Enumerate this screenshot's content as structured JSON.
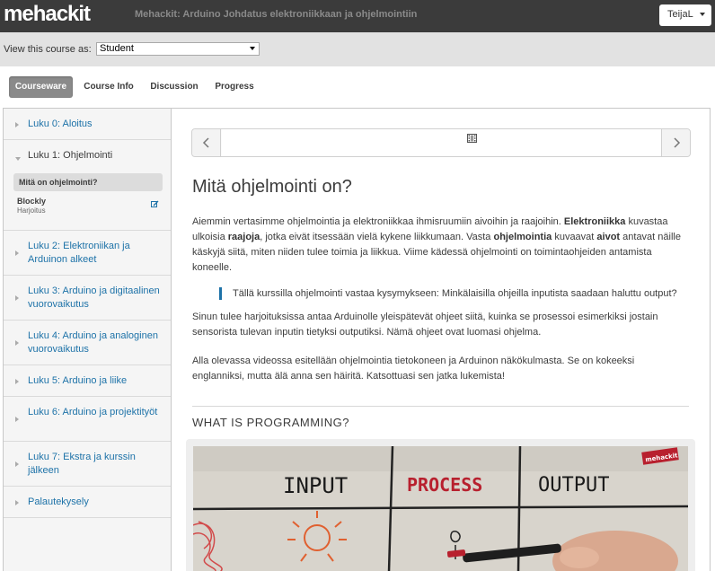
{
  "header": {
    "logo": "mehackit",
    "course_title": "Mehackit: Arduino Johdatus elektroniikkaan ja ohjelmointiin",
    "user_button": "TeijaL"
  },
  "view_bar": {
    "label": "View this course as:",
    "selected": "Student"
  },
  "tabs": [
    {
      "label": "Courseware",
      "active": true
    },
    {
      "label": "Course Info",
      "active": false
    },
    {
      "label": "Discussion",
      "active": false
    },
    {
      "label": "Progress",
      "active": false
    }
  ],
  "sidebar": {
    "chapters": [
      {
        "label": "Luku 0: Aloitus"
      },
      {
        "label": "Luku 1: Ohjelmointi"
      },
      {
        "label": "Luku 2: Elektroniikan ja Arduinon alkeet"
      },
      {
        "label": "Luku 3: Arduino ja digitaalinen vuorovaikutus"
      },
      {
        "label": "Luku 4: Arduino ja analoginen vuorovaikutus"
      },
      {
        "label": "Luku 5: Arduino ja liike"
      },
      {
        "label": "Luku 6: Arduino ja projektityöt"
      },
      {
        "label": "Luku 7: Ekstra ja kurssin jälkeen"
      },
      {
        "label": "Palautekysely"
      }
    ],
    "open_chapter_items": [
      {
        "name": "Mitä on ohjelmointi?",
        "active": true
      },
      {
        "name": "Blockly",
        "sub": "Harjoitus",
        "active": false
      }
    ]
  },
  "content": {
    "title": "Mitä ohjelmointi on?",
    "para1": {
      "t1": "Aiemmin vertasimme ohjelmointia ja elektroniikkaa ihmisruumiin aivoihin ja raajoihin. ",
      "b1": "Elektroniikka",
      "t2": " kuvastaa ulkoisia ",
      "b2": "raajoja",
      "t3": ", jotka eivät itsessään vielä kykene liikkumaan. Vasta ",
      "b3": "ohjelmointia",
      "t4": " kuvaavat ",
      "b4": "aivot",
      "t5": " antavat näille käskyjä siitä, miten niiden tulee toimia ja liikkua. Viime kädessä ohjelmointi on toimintaohjeiden antamista koneelle."
    },
    "quote": "Tällä kurssilla ohjelmointi vastaa kysymykseen: Minkälaisilla ohjeilla inputista saadaan haluttu output?",
    "para2": "Sinun tulee harjoituksissa antaa Arduinolle yleispätevät ohjeet siitä, kuinka se prosessoi esimerkiksi jostain sensorista tulevan inputin tietyksi outputiksi. Nämä ohjeet ovat luomasi ohjelma.",
    "para3": "Alla olevassa videossa esitellään ohjelmointia tietokoneen ja Arduinon näkökulmasta. Se on kokeeksi englanniksi, mutta älä anna sen häiritä. Katsottuasi sen jatka lukemista!",
    "video_heading": "WHAT IS PROGRAMMING?",
    "video": {
      "word_input": "INPUT",
      "word_process": "PROCESS",
      "word_output": "OUTPUT",
      "watermark": "mehackit"
    }
  }
}
